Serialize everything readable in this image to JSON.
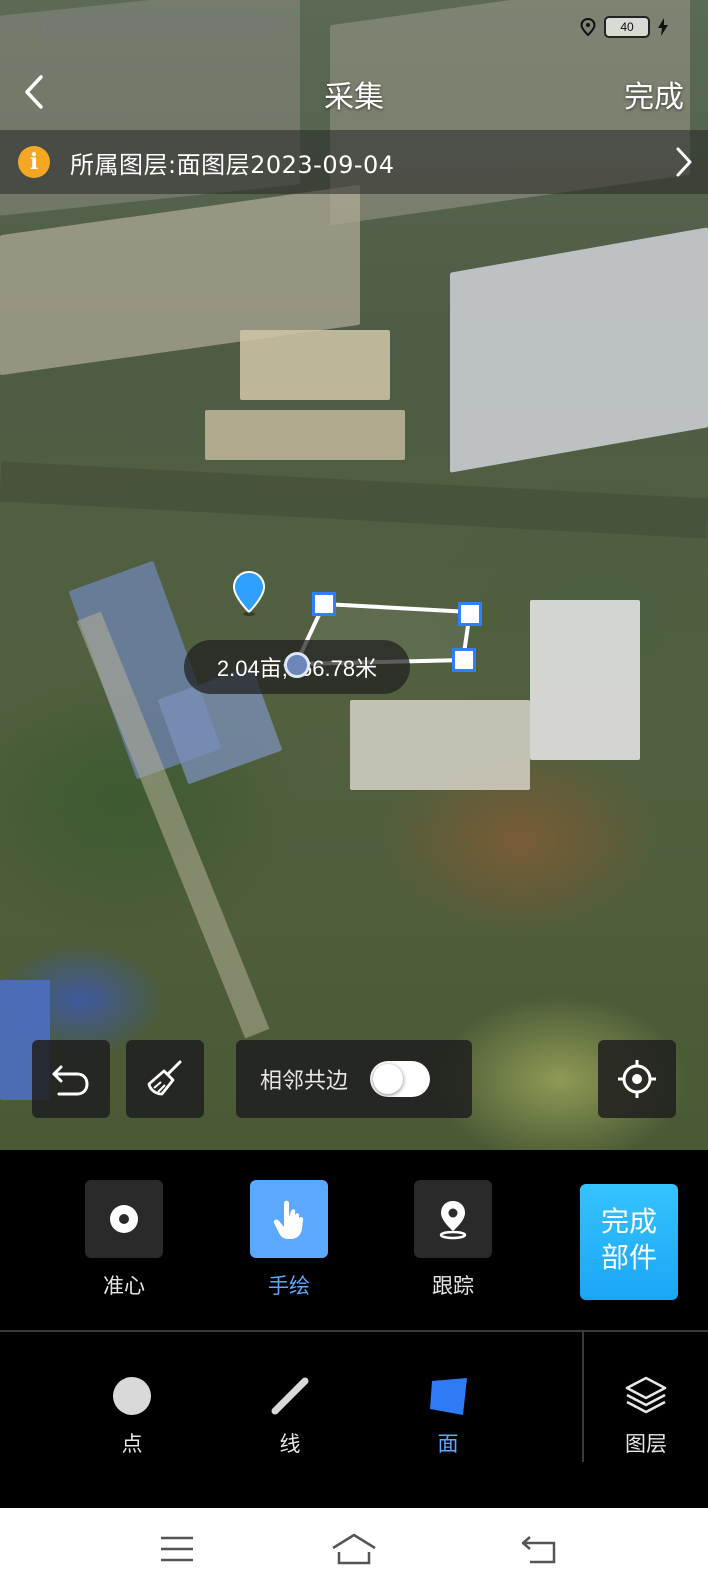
{
  "status_bar": {
    "battery": "40"
  },
  "header": {
    "title": "采集",
    "done_label": "完成"
  },
  "layer_notice": {
    "text": "所属图层:面图层2023-09-04"
  },
  "map": {
    "measure_label": "2.04亩;166.78米"
  },
  "map_tools": {
    "adjacent_edge_label": "相邻共边",
    "adjacent_edge_on": false
  },
  "modes": {
    "items": [
      {
        "label": "准心",
        "icon": "crosshair-dot-icon",
        "active": false
      },
      {
        "label": "手绘",
        "icon": "hand-touch-icon",
        "active": true
      },
      {
        "label": "跟踪",
        "icon": "track-pin-icon",
        "active": false
      }
    ],
    "finish_part_line1": "完成",
    "finish_part_line2": "部件"
  },
  "geometry": {
    "items": [
      {
        "label": "点",
        "icon": "point-icon",
        "active": false
      },
      {
        "label": "线",
        "icon": "line-icon",
        "active": false
      },
      {
        "label": "面",
        "icon": "polygon-icon",
        "active": true
      }
    ],
    "layers_label": "图层"
  },
  "colors": {
    "accent": "#5aa8ff",
    "finish_button": "#1aa6f5",
    "info": "#f5a623",
    "vertex_border": "#2f80ff"
  }
}
